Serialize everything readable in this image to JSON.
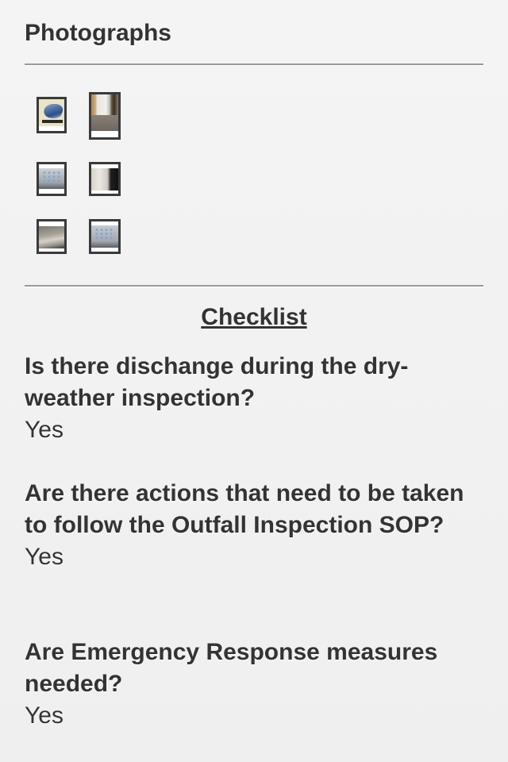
{
  "photographs": {
    "title": "Photographs",
    "thumbnails": [
      {
        "subject": "rice-creek-logo"
      },
      {
        "subject": "hallway-photo"
      },
      {
        "subject": "tablet-homescreen-photo"
      },
      {
        "subject": "wall-and-device-photo"
      },
      {
        "subject": "blurry-surface-photo"
      },
      {
        "subject": "tablet-homescreen-photo"
      }
    ]
  },
  "checklist": {
    "heading": "Checklist",
    "items": [
      {
        "question": "Is there dischange during the dry-weather inspection?",
        "answer": "Yes"
      },
      {
        "question": "Are there actions that need to be taken to follow the Outfall Inspection SOP?",
        "answer": "Yes"
      },
      {
        "question": "Are Emergency Response measures needed?",
        "answer": "Yes"
      }
    ]
  },
  "colors": {
    "background": "#f3f3f3",
    "text": "#333333",
    "divider": "#9a9a9a",
    "thumb_border": "#3a3a3a"
  }
}
